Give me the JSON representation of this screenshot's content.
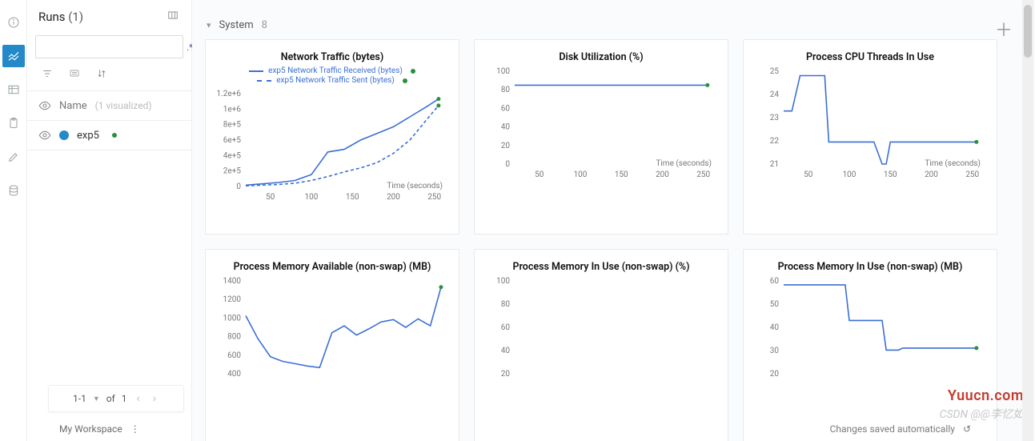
{
  "iconbar": {
    "items": [
      "info",
      "charts",
      "table",
      "clipboard",
      "brush",
      "db"
    ],
    "active": 1
  },
  "runs": {
    "title": "Runs",
    "count_label": "(1)",
    "search_placeholder": "",
    "header_label": "Name",
    "header_sub": "(1 visualized)",
    "items": [
      {
        "name": "exp5",
        "color": "#2389c9",
        "status_color": "#2a8f3c"
      }
    ],
    "pager": {
      "range": "1-1",
      "of_label": "of",
      "total": "1"
    }
  },
  "section": {
    "name": "System",
    "count": "8"
  },
  "footer": {
    "workspace": "My Workspace",
    "saved": "Changes saved automatically",
    "undo_icon": "↺"
  },
  "watermarks": {
    "w1": "Yuucn.com",
    "w2": "CSDN @@李忆如"
  },
  "charts": [
    {
      "title": "Network Traffic (bytes)",
      "xlabel": "Time (seconds)",
      "legend": [
        {
          "label": "exp5 Network Traffic Received (bytes)",
          "style": "solid"
        },
        {
          "label": "exp5 Network Traffic Sent (bytes)",
          "style": "dashed"
        }
      ],
      "y_ticks": [
        "0",
        "2e+5",
        "4e+5",
        "6e+5",
        "8e+5",
        "1e+6",
        "1.2e+6"
      ],
      "x_ticks": [
        "50",
        "100",
        "150",
        "200",
        "250"
      ]
    },
    {
      "title": "Disk Utilization (%)",
      "xlabel": "Time (seconds)",
      "y_ticks": [
        "0",
        "20",
        "40",
        "60",
        "80",
        "100"
      ],
      "x_ticks": [
        "50",
        "100",
        "150",
        "200",
        "250"
      ]
    },
    {
      "title": "Process CPU Threads In Use",
      "xlabel": "Time (seconds)",
      "y_ticks": [
        "21",
        "22",
        "23",
        "24",
        "25"
      ],
      "x_ticks": [
        "50",
        "100",
        "150",
        "200",
        "250"
      ]
    },
    {
      "title": "Process Memory Available (non-swap) (MB)",
      "xlabel": "",
      "y_ticks": [
        "400",
        "600",
        "800",
        "1000",
        "1200",
        "1400"
      ],
      "x_ticks": []
    },
    {
      "title": "Process Memory In Use (non-swap) (%)",
      "xlabel": "",
      "y_ticks": [
        "20",
        "40",
        "60",
        "80",
        "100"
      ],
      "x_ticks": []
    },
    {
      "title": "Process Memory In Use (non-swap) (MB)",
      "xlabel": "",
      "y_ticks": [
        "20",
        "30",
        "40",
        "50",
        "60"
      ],
      "x_ticks": []
    }
  ],
  "chart_data": [
    {
      "type": "line",
      "title": "Network Traffic (bytes)",
      "xlabel": "Time (seconds)",
      "ylabel": "",
      "xlim": [
        20,
        260
      ],
      "ylim": [
        0,
        1400000
      ],
      "series": [
        {
          "name": "exp5 Network Traffic Received (bytes)",
          "style": "solid",
          "x": [
            20,
            40,
            60,
            80,
            100,
            120,
            140,
            160,
            180,
            200,
            220,
            240,
            255
          ],
          "y": [
            20000,
            40000,
            60000,
            90000,
            180000,
            520000,
            560000,
            700000,
            800000,
            900000,
            1050000,
            1200000,
            1320000
          ]
        },
        {
          "name": "exp5 Network Traffic Sent (bytes)",
          "style": "dashed",
          "x": [
            20,
            40,
            60,
            80,
            100,
            120,
            140,
            160,
            180,
            200,
            220,
            240,
            255
          ],
          "y": [
            10000,
            20000,
            30000,
            50000,
            90000,
            150000,
            220000,
            280000,
            360000,
            500000,
            700000,
            1000000,
            1220000
          ]
        }
      ]
    },
    {
      "type": "line",
      "title": "Disk Utilization (%)",
      "xlabel": "Time (seconds)",
      "ylabel": "",
      "xlim": [
        20,
        260
      ],
      "ylim": [
        0,
        100
      ],
      "series": [
        {
          "name": "exp5",
          "x": [
            20,
            255
          ],
          "y": [
            85,
            85
          ]
        }
      ]
    },
    {
      "type": "line",
      "title": "Process CPU Threads In Use",
      "xlabel": "Time (seconds)",
      "ylabel": "",
      "xlim": [
        20,
        260
      ],
      "ylim": [
        21,
        25.2
      ],
      "series": [
        {
          "name": "exp5",
          "x": [
            20,
            30,
            40,
            60,
            70,
            75,
            80,
            130,
            140,
            145,
            150,
            155,
            255
          ],
          "y": [
            23.4,
            23.4,
            25,
            25,
            25,
            22,
            22,
            22,
            21,
            21,
            22,
            22,
            22
          ]
        }
      ]
    },
    {
      "type": "line",
      "title": "Process Memory Available (non-swap) (MB)",
      "xlabel": "Time (seconds)",
      "ylabel": "",
      "xlim": [
        20,
        260
      ],
      "ylim": [
        300,
        1500
      ],
      "series": [
        {
          "name": "exp5",
          "x": [
            20,
            35,
            50,
            65,
            80,
            95,
            110,
            125,
            140,
            155,
            170,
            185,
            200,
            215,
            230,
            245,
            258
          ],
          "y": [
            1050,
            750,
            520,
            460,
            430,
            400,
            380,
            830,
            920,
            800,
            880,
            970,
            1000,
            900,
            1010,
            920,
            1420
          ]
        }
      ]
    },
    {
      "type": "line",
      "title": "Process Memory In Use (non-swap) (%)",
      "xlabel": "Time (seconds)",
      "ylabel": "",
      "xlim": [
        20,
        260
      ],
      "ylim": [
        10,
        100
      ],
      "series": []
    },
    {
      "type": "line",
      "title": "Process Memory In Use (non-swap) (MB)",
      "xlabel": "Time (seconds)",
      "ylabel": "",
      "xlim": [
        20,
        260
      ],
      "ylim": [
        18,
        65
      ],
      "series": [
        {
          "name": "exp5",
          "x": [
            20,
            30,
            95,
            100,
            140,
            145,
            160,
            165,
            255
          ],
          "y": [
            63,
            63,
            63,
            45,
            45,
            30,
            30,
            31,
            31
          ]
        }
      ]
    }
  ]
}
